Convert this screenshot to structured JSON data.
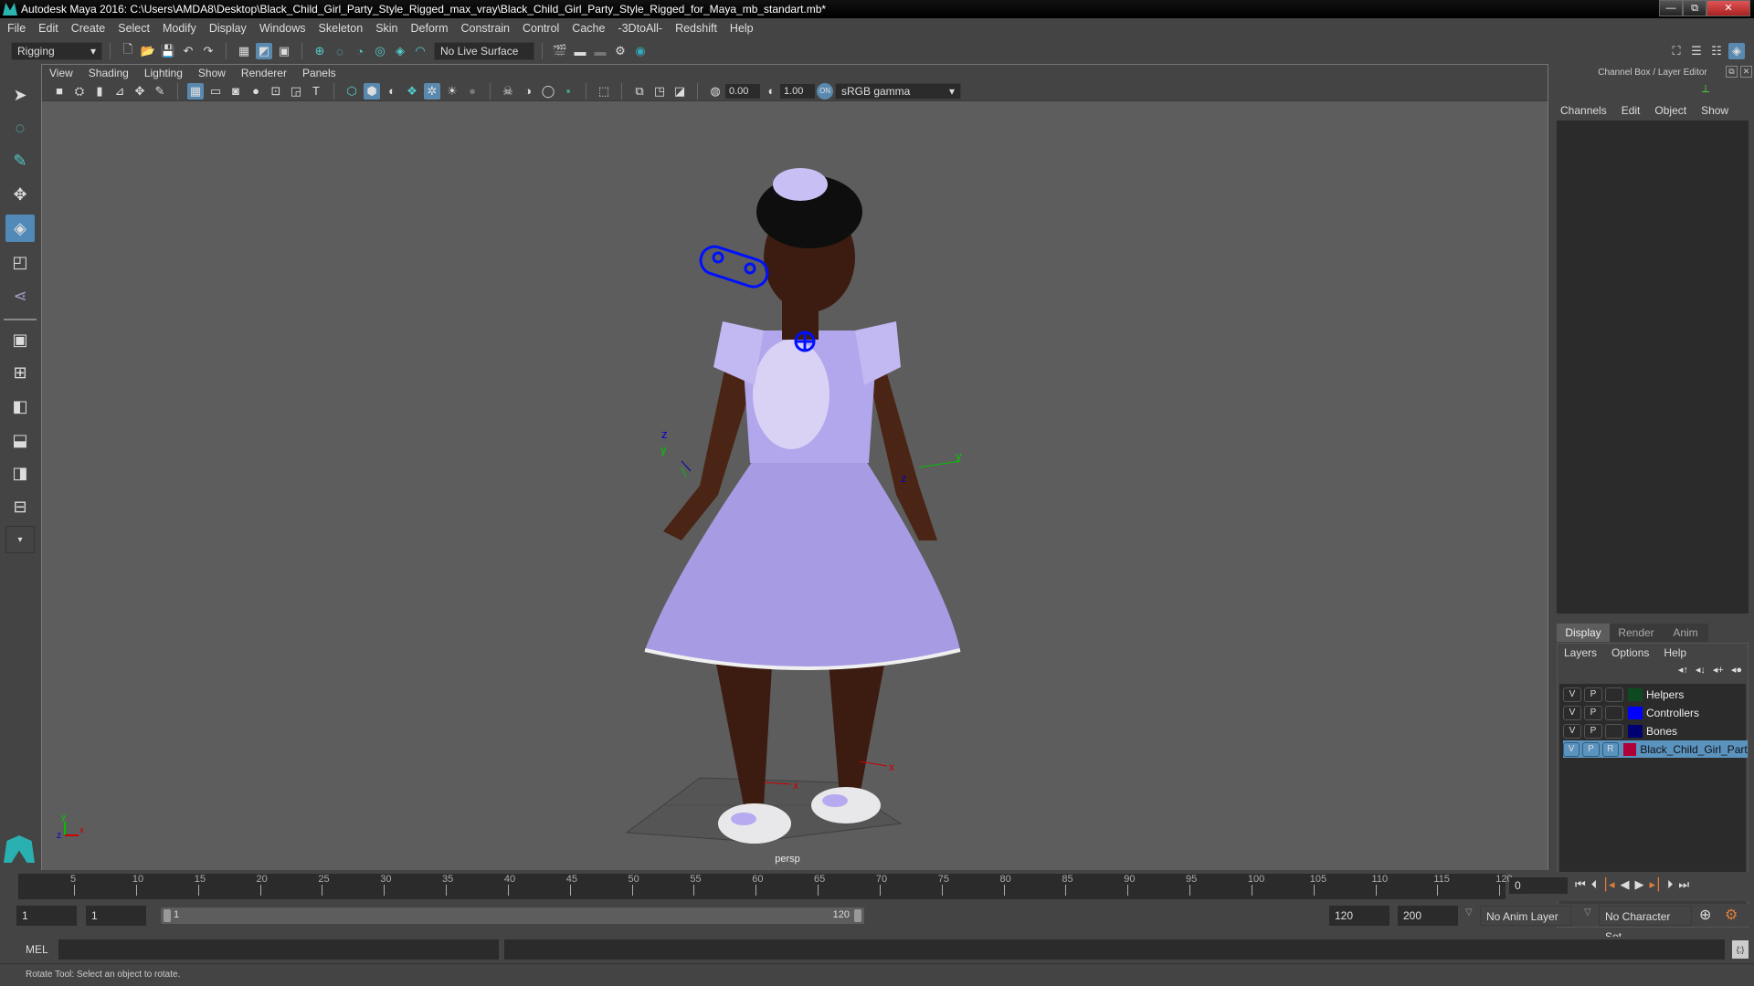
{
  "window": {
    "title": "Autodesk Maya 2016: C:\\Users\\AMDA8\\Desktop\\Black_Child_Girl_Party_Style_Rigged_max_vray\\Black_Child_Girl_Party_Style_Rigged_for_Maya_mb_standart.mb*",
    "minimize": "—",
    "restore": "⧉",
    "close": "✕"
  },
  "menubar": [
    "File",
    "Edit",
    "Create",
    "Select",
    "Modify",
    "Display",
    "Windows",
    "Skeleton",
    "Skin",
    "Deform",
    "Constrain",
    "Control",
    "Cache",
    "-3DtoAll-",
    "Redshift",
    "Help"
  ],
  "shelf": {
    "mode": "Rigging",
    "live_surface": "No Live Surface"
  },
  "viewport": {
    "menu": [
      "View",
      "Shading",
      "Lighting",
      "Show",
      "Renderer",
      "Panels"
    ],
    "exposure": "0.00",
    "gamma": "1.00",
    "color_space": "sRGB gamma",
    "camera_label": "persp",
    "axis_labels": {
      "x": "x",
      "y": "y",
      "z": "z"
    }
  },
  "left_toolbox": {
    "active_tool": "rotate-tool",
    "tools": [
      "select-tool",
      "lasso-tool",
      "paint-select-tool",
      "move-tool",
      "rotate-tool",
      "scale-tool",
      "show-manipulator-tool"
    ]
  },
  "right_panel": {
    "title": "Channel Box / Layer Editor",
    "channel_menu": [
      "Channels",
      "Edit",
      "Object",
      "Show"
    ],
    "layer_tabs": [
      "Display",
      "Render",
      "Anim"
    ],
    "active_tab": "Display",
    "layer_menu": [
      "Layers",
      "Options",
      "Help"
    ],
    "layers": [
      {
        "v": "V",
        "p": "P",
        "r": "",
        "name": "Helpers",
        "color": "#0e4a1f",
        "selected": false
      },
      {
        "v": "V",
        "p": "P",
        "r": "",
        "name": "Controllers",
        "color": "#0000ff",
        "selected": false
      },
      {
        "v": "V",
        "p": "P",
        "r": "",
        "name": "Bones",
        "color": "#000070",
        "selected": false
      },
      {
        "v": "V",
        "p": "P",
        "r": "R",
        "name": "Black_Child_Girl_Party_",
        "color": "#b0003a",
        "selected": true
      }
    ]
  },
  "timeline": {
    "ticks": [
      5,
      10,
      15,
      20,
      25,
      30,
      35,
      40,
      45,
      50,
      55,
      60,
      65,
      70,
      75,
      80,
      85,
      90,
      95,
      100,
      105,
      110,
      115,
      120
    ],
    "range_start": 1,
    "range_end": 120,
    "current_frame": "0"
  },
  "range_slider": {
    "start_time": "1",
    "playback_start": "1",
    "slider_start": "1",
    "slider_end": "120",
    "playback_end": "120",
    "end_time": "200",
    "anim_layer": "No Anim Layer",
    "character_set": "No Character Set"
  },
  "command_line": {
    "label": "MEL",
    "value": "",
    "result": ""
  },
  "help_line": "Rotate Tool: Select an object to rotate."
}
